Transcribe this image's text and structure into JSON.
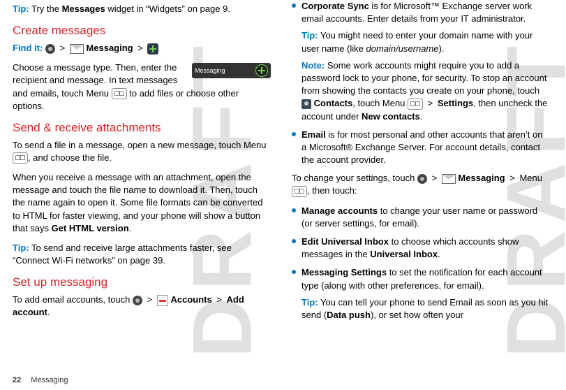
{
  "watermark": "DRAFT",
  "left": {
    "tip1_label": "Tip:",
    "tip1_text_a": " Try the ",
    "tip1_bold": "Messages",
    "tip1_text_b": " widget in “Widgets” on page 9.",
    "h1": "Create messages",
    "findit_label": "Find it:",
    "findit_gt1": ">",
    "findit_messaging": "Messaging",
    "findit_gt2": ">",
    "widget_label": "Messaging",
    "p1": "Choose a message type. Then, enter the recipient and message. In text messages and emails, touch Menu ",
    "p1b": " to add files or choose other options.",
    "h2": "Send & receive attachments",
    "p2": "To send a file in a message, open a new message, touch Menu ",
    "p2b": ", and choose the file.",
    "p3a": "When you receive a message with an attachment, open the message and touch the file name to download it. Then, touch the name again to open it. Some file formats can be converted to HTML for faster viewing, and your phone will show a button that says ",
    "p3bold": "Get HTML version",
    "p3b": ".",
    "tip2_label": "Tip:",
    "tip2_text": " To send and receive large attachments faster, see “Connect Wi-Fi networks” on page 39.",
    "h3": "Set up messaging",
    "p4a": "To add email accounts, touch ",
    "p4gt": ">",
    "p4_accounts": "Accounts",
    "p4gt2": ">",
    "p4_add": "Add account",
    "p4b": "."
  },
  "right": {
    "li1_bold": "Corporate Sync",
    "li1_text": " is for Microsoft™ Exchange server work email accounts. Enter details from your IT administrator.",
    "li1_tip_label": "Tip:",
    "li1_tip_a": " You might need to enter your domain name with your user name (like ",
    "li1_tip_italic": "domain/username",
    "li1_tip_b": ").",
    "li1_note_label": "Note:",
    "li1_note_a": " Some work accounts might require you to add a password lock to your phone, for security. To stop an account from showing the contacts you create on your phone, touch ",
    "li1_note_contacts": "Contacts",
    "li1_note_b": ", touch Menu ",
    "li1_note_gt": ">",
    "li1_note_settings": "Settings",
    "li1_note_c": ", then uncheck the account under ",
    "li1_note_new": "New contacts",
    "li1_note_d": ".",
    "li2_bold": "Email",
    "li2_text": " is for most personal and other accounts that aren’t on a Microsoft® Exchange Server. For account details, contact the account provider.",
    "p5a": "To change your settings, touch ",
    "p5gt": ">",
    "p5_messaging": "Messaging",
    "p5gt2": ">",
    "p5b": " Menu ",
    "p5c": ", then touch:",
    "li3_bold": "Manage accounts",
    "li3_text": " to change your user name or password (or server settings, for email).",
    "li4_bold": "Edit Universal Inbox",
    "li4_a": " to choose which accounts show messages in the ",
    "li4_ui": "Universal Inbox",
    "li4_b": ".",
    "li5_bold": "Messaging Settings",
    "li5_text": " to set the notification for each account type (along with other preferences, for email).",
    "li5_tip_label": "Tip:",
    "li5_tip_a": " You can tell your phone to send Email as soon as you hit send (",
    "li5_tip_bold": "Data push",
    "li5_tip_b": "), or set how often your"
  },
  "footer": {
    "page": "22",
    "section": "Messaging"
  }
}
